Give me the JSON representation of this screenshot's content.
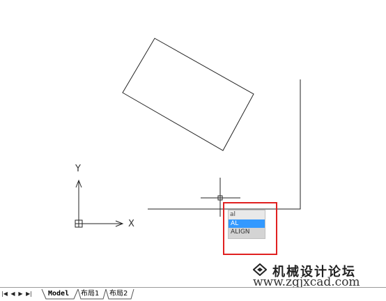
{
  "ucs": {
    "x_label": "X",
    "y_label": "Y"
  },
  "autocomplete": {
    "input": "al",
    "items": [
      {
        "label": "AL",
        "selected": true
      },
      {
        "label": "ALIGN",
        "selected": false
      }
    ]
  },
  "watermark": {
    "title": "机械设计论坛",
    "url": "www.zgjxcad.com"
  },
  "layout_tabs": {
    "nav": [
      "first",
      "prev",
      "next",
      "last"
    ],
    "tabs": [
      {
        "label": "Model",
        "active": true
      },
      {
        "label": "布局1",
        "active": false
      },
      {
        "label": "布局2",
        "active": false
      }
    ]
  },
  "colors": {
    "highlight": "#e02020",
    "selection": "#3399ff",
    "background": "#ffffff"
  }
}
